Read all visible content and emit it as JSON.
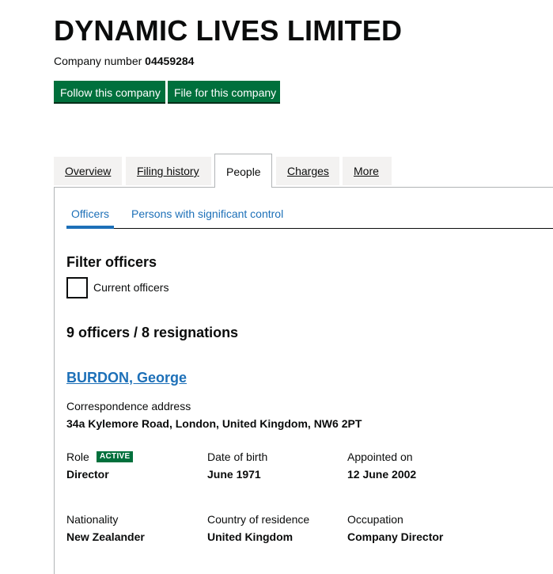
{
  "company": {
    "name": "DYNAMIC LIVES LIMITED",
    "number_label": "Company number",
    "number": "04459284"
  },
  "actions": {
    "follow": "Follow this company",
    "file": "File for this company"
  },
  "tabs": [
    {
      "label": "Overview"
    },
    {
      "label": "Filing history"
    },
    {
      "label": "People",
      "active": true
    },
    {
      "label": "Charges"
    },
    {
      "label": "More"
    }
  ],
  "subtabs": [
    {
      "label": "Officers",
      "active": true
    },
    {
      "label": "Persons with significant control"
    }
  ],
  "filter": {
    "heading": "Filter officers",
    "checkbox_label": "Current officers",
    "checked": false
  },
  "counts": {
    "text": "9 officers / 8 resignations"
  },
  "officer": {
    "name": "BURDON, George",
    "address_label": "Correspondence address",
    "address": "34a Kylemore Road, London, United Kingdom, NW6 2PT",
    "role_label": "Role",
    "status": "ACTIVE",
    "role": "Director",
    "dob_label": "Date of birth",
    "dob": "June 1971",
    "appointed_label": "Appointed on",
    "appointed": "12 June 2002",
    "nationality_label": "Nationality",
    "nationality": "New Zealander",
    "residence_label": "Country of residence",
    "residence": "United Kingdom",
    "occupation_label": "Occupation",
    "occupation": "Company Director"
  },
  "colors": {
    "primary_green": "#00703c",
    "link_blue": "#1d70b8",
    "tab_grey": "#f3f2f1",
    "text": "#0b0c0c"
  }
}
